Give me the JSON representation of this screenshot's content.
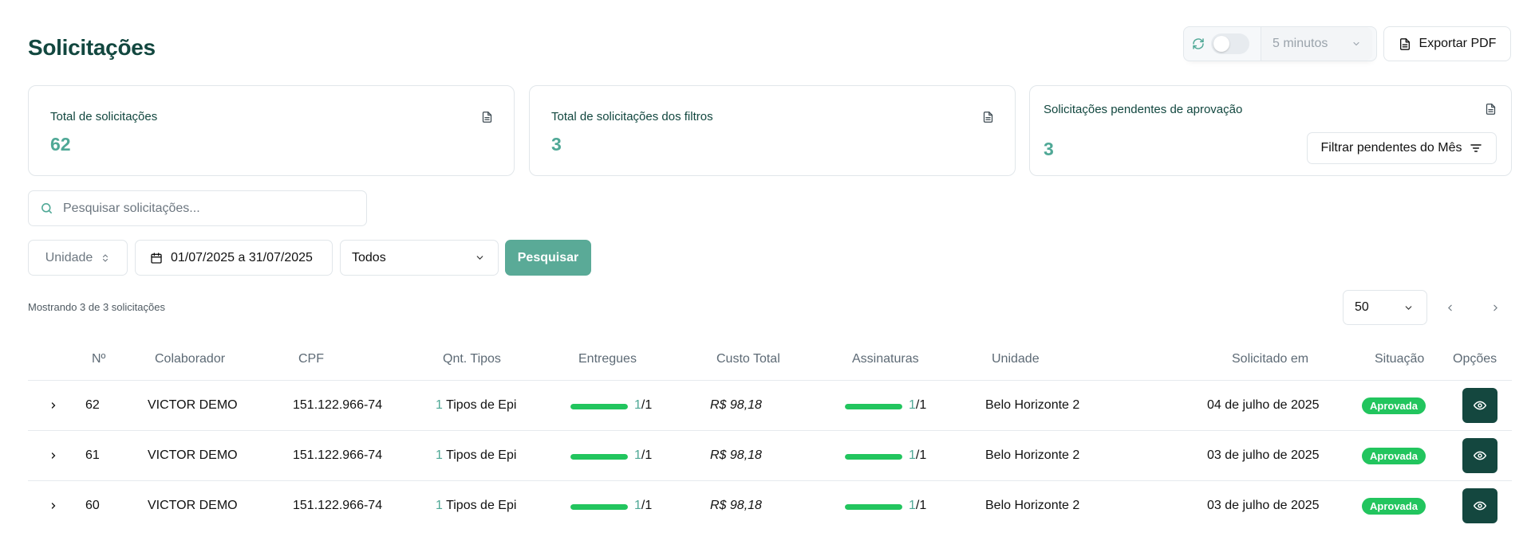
{
  "page": {
    "title": "Solicitações"
  },
  "toolbar": {
    "interval_value": "5 minutos",
    "export_label": "Exportar PDF",
    "colors": {
      "primary": "#14473f",
      "accent": "#4fa896",
      "success": "#22c55e"
    }
  },
  "stats": {
    "total_label": "Total de solicitações",
    "total_value": "62",
    "filtered_label": "Total de solicitações dos filtros",
    "filtered_value": "3",
    "pending_label": "Solicitações pendentes de aprovação",
    "pending_value": "3",
    "pending_filter_label": "Filtrar pendentes do Mês"
  },
  "search": {
    "placeholder": "Pesquisar solicitações..."
  },
  "filters": {
    "unidade_label": "Unidade",
    "date_range": "01/07/2025 a 31/07/2025",
    "status_value": "Todos",
    "search_button": "Pesquisar"
  },
  "pagination": {
    "showing_text": "Mostrando 3 de 3 solicitações",
    "page_size": "50"
  },
  "table": {
    "headers": {
      "numero": "Nº",
      "colaborador": "Colaborador",
      "cpf": "CPF",
      "qnt_tipos": "Qnt. Tipos",
      "entregues": "Entregues",
      "custo_total": "Custo Total",
      "assinaturas": "Assinaturas",
      "unidade": "Unidade",
      "solicitado_em": "Solicitado em",
      "situacao": "Situação",
      "opcoes": "Opções"
    },
    "rows": [
      {
        "numero": "62",
        "colaborador": "VICTOR DEMO",
        "cpf": "151.122.966-74",
        "tipos_count": "1",
        "tipos_label": "Tipos de Epi",
        "entregues_done": "1",
        "entregues_total": "1",
        "entregues_fraction": 1,
        "custo": "R$ 98,18",
        "assin_done": "1",
        "assin_total": "1",
        "assin_fraction": 1,
        "unidade": "Belo Horizonte 2",
        "solicitado": "04 de julho de 2025",
        "situacao": "Aprovada"
      },
      {
        "numero": "61",
        "colaborador": "VICTOR DEMO",
        "cpf": "151.122.966-74",
        "tipos_count": "1",
        "tipos_label": "Tipos de Epi",
        "entregues_done": "1",
        "entregues_total": "1",
        "entregues_fraction": 1,
        "custo": "R$ 98,18",
        "assin_done": "1",
        "assin_total": "1",
        "assin_fraction": 1,
        "unidade": "Belo Horizonte 2",
        "solicitado": "03 de julho de 2025",
        "situacao": "Aprovada"
      },
      {
        "numero": "60",
        "colaborador": "VICTOR DEMO",
        "cpf": "151.122.966-74",
        "tipos_count": "1",
        "tipos_label": "Tipos de Epi",
        "entregues_done": "1",
        "entregues_total": "1",
        "entregues_fraction": 1,
        "custo": "R$ 98,18",
        "assin_done": "1",
        "assin_total": "1",
        "assin_fraction": 1,
        "unidade": "Belo Horizonte 2",
        "solicitado": "03 de julho de 2025",
        "situacao": "Aprovada"
      }
    ]
  }
}
